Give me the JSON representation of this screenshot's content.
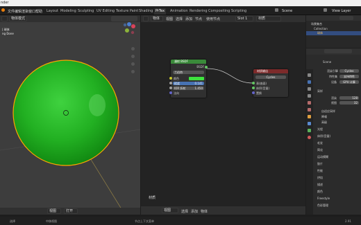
{
  "window": {
    "app_title": "nder",
    "scene_label": "Scene",
    "view_layer_label": "View Layer"
  },
  "menu": {
    "items": [
      "文件",
      "编辑",
      "渲染",
      "窗口",
      "帮助"
    ]
  },
  "workspaces": {
    "tabs": [
      "Layout",
      "Modeling",
      "Sculpting",
      "UV Editing",
      "Texture Paint",
      "Shading",
      "PrTex",
      "Animation",
      "Rendering",
      "Compositing",
      "Scripting"
    ],
    "active_index": 6
  },
  "viewport": {
    "overlay_lines": [
      "| 球体",
      "ng Done"
    ],
    "view_labels": [
      "视图",
      "选择",
      "添加",
      "物体"
    ],
    "mode_label": "物体模式",
    "gizmo_labels": [
      "Y",
      "X",
      "Z"
    ]
  },
  "node_editor": {
    "header_labels": [
      "物体",
      "视图",
      "选择",
      "添加",
      "节点",
      "使用节点"
    ],
    "slot_label": "Slot 1",
    "material_label": "材质",
    "bottom_label": "材质",
    "bsdf_node": {
      "title": "漫射 BSDF",
      "output_label": "BSDF",
      "dropdown": "兰伯特",
      "rows": [
        {
          "label": "颜色"
        },
        {
          "label": "糙度",
          "value": "0.141"
        },
        {
          "label": "IOR 折射",
          "value": "1.450"
        },
        {
          "label": "法向"
        }
      ]
    },
    "output_node": {
      "title": "材质输出",
      "dropdown": "Cycles",
      "rows": [
        "表(曲面)",
        "体积(音量)",
        "置换"
      ]
    }
  },
  "outliner": {
    "rows": [
      "场景集合",
      "Collection",
      "球体"
    ]
  },
  "properties": {
    "scene_label": "Scene",
    "render_engine_label": "渲染引擎",
    "render_engine_value": "Cycles",
    "feature_set_label": "特性集",
    "feature_set_value": "支持特性",
    "device_label": "设备",
    "device_value": "GPU 计算",
    "sampling_label": "采样",
    "render_label": "渲染",
    "render_value": "128",
    "viewport_label": "视图",
    "viewport_value": "32",
    "panels": [
      "自适应采样",
      "降噪",
      "高级",
      "光程",
      "体积(音量)",
      "毛发",
      "简化",
      "运动模糊",
      "胶片",
      "性能",
      "烘焙",
      "描述",
      "颜色",
      "Freestyle",
      "色彩管理"
    ]
  },
  "status": {
    "left_items": [
      "选择",
      "中移视图"
    ],
    "center_items": [
      "节点上下文菜单"
    ],
    "bottom_buttons": [
      "视图",
      "打开"
    ],
    "version": "2.91"
  },
  "colors": {
    "accent": "#4772b3",
    "sphere": "#2ab42a",
    "outline": "#ffa500",
    "active_bsdf": "#3a8a3a",
    "output_header": "#7c2a2a"
  }
}
